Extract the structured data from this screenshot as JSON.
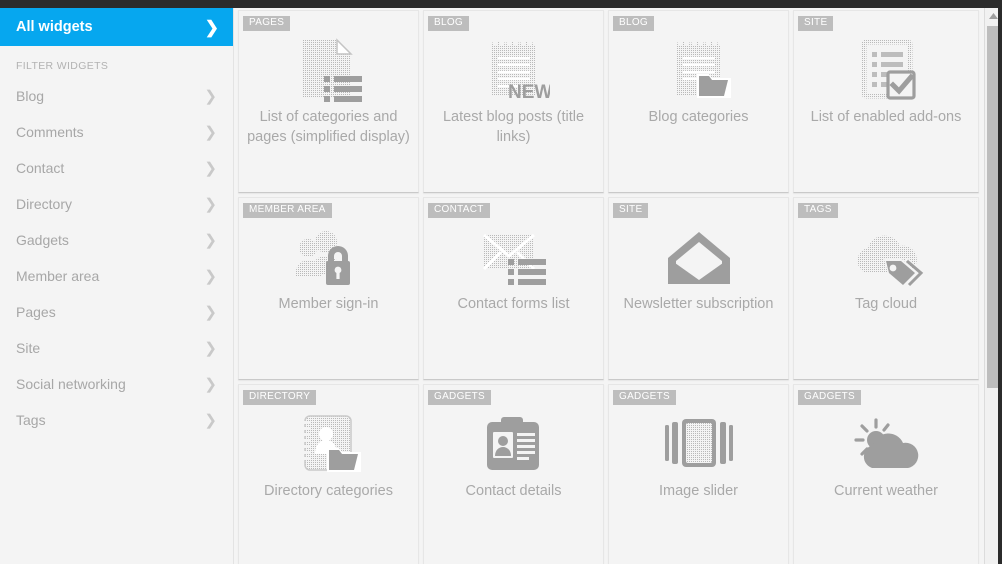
{
  "sidebar": {
    "all_widgets": {
      "label": "All widgets",
      "chevron": "chevron-right-icon"
    },
    "filter_heading": "FILTER WIDGETS",
    "items": [
      {
        "label": "Blog"
      },
      {
        "label": "Comments"
      },
      {
        "label": "Contact"
      },
      {
        "label": "Directory"
      },
      {
        "label": "Gadgets"
      },
      {
        "label": "Member area"
      },
      {
        "label": "Pages"
      },
      {
        "label": "Site"
      },
      {
        "label": "Social networking"
      },
      {
        "label": "Tags"
      }
    ]
  },
  "colors": {
    "accent": "#06a7ef",
    "badge": "#bdbdbd",
    "icon": "#9e9e9e",
    "text_muted": "#a9a9a9",
    "page_bg": "#f4f4f4",
    "topbar": "#2b2b2b"
  },
  "scrollbar": {
    "up_arrow": "scroll-up-arrow-icon",
    "thumb_label": "scrollbar-thumb"
  },
  "widgets": [
    {
      "badge": "PAGES",
      "label": "List of categories and pages (simplified display)",
      "icon": "document-list-icon"
    },
    {
      "badge": "BLOG",
      "label": "Latest blog posts (title links)",
      "icon": "notepad-new-icon"
    },
    {
      "badge": "BLOG",
      "label": "Blog categories",
      "icon": "notepad-folder-icon"
    },
    {
      "badge": "SITE",
      "label": "List of enabled add-ons",
      "icon": "checklist-icon"
    },
    {
      "badge": "MEMBER AREA",
      "label": "Member sign-in",
      "icon": "users-lock-icon"
    },
    {
      "badge": "CONTACT",
      "label": "Contact forms list",
      "icon": "envelope-list-icon"
    },
    {
      "badge": "SITE",
      "label": "Newsletter subscription",
      "icon": "open-envelope-icon"
    },
    {
      "badge": "TAGS",
      "label": "Tag cloud",
      "icon": "cloud-tag-icon"
    },
    {
      "badge": "DIRECTORY",
      "label": "Directory categories",
      "icon": "address-book-folder-icon"
    },
    {
      "badge": "GADGETS",
      "label": "Contact details",
      "icon": "clipboard-id-icon"
    },
    {
      "badge": "GADGETS",
      "label": "Image slider",
      "icon": "image-slider-icon"
    },
    {
      "badge": "GADGETS",
      "label": "Current weather",
      "icon": "sun-cloud-icon"
    }
  ],
  "icon_glyphs": {
    "notepad_new_text": "NEW"
  }
}
